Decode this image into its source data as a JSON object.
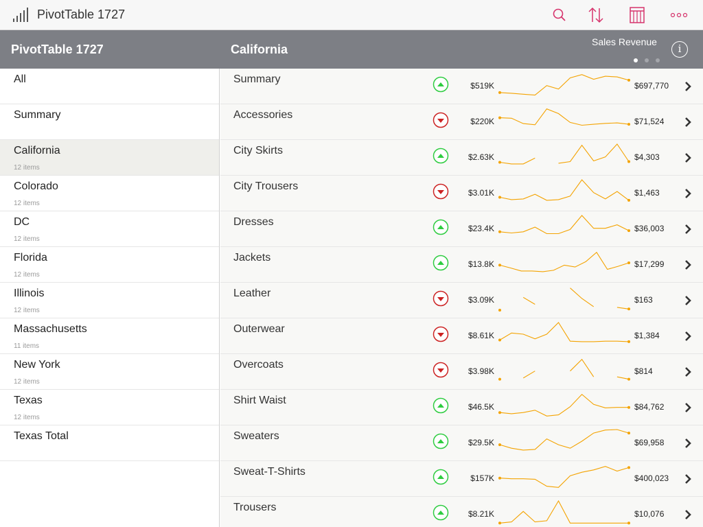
{
  "app": {
    "title": "PivotTable 1727",
    "logo_icon": "bar-chart-logo-icon"
  },
  "toolbar": {
    "icons": [
      "search-icon",
      "sort-icon",
      "columns-icon",
      "more-icon"
    ],
    "accent_color": "#d6336c"
  },
  "left_panel": {
    "title": "PivotTable 1727",
    "items": [
      {
        "label": "All",
        "sub": ""
      },
      {
        "label": "Summary",
        "sub": ""
      },
      {
        "label": "California",
        "sub": "12 items"
      },
      {
        "label": "Colorado",
        "sub": "12 items"
      },
      {
        "label": "DC",
        "sub": "12 items"
      },
      {
        "label": "Florida",
        "sub": "12 items"
      },
      {
        "label": "Illinois",
        "sub": "12 items"
      },
      {
        "label": "Massachusetts",
        "sub": "11 items"
      },
      {
        "label": "New York",
        "sub": "12 items"
      },
      {
        "label": "Texas",
        "sub": "12 items"
      },
      {
        "label": "Texas  Total",
        "sub": ""
      }
    ],
    "selected": "California"
  },
  "right_panel": {
    "title": "California",
    "measure": "Sales Revenue",
    "page_dots": 3,
    "active_dot": 0
  },
  "colors": {
    "up": "#2ecc40",
    "down": "#cc2222",
    "spark": "#f4a300",
    "header_bg": "#7d7f85"
  },
  "rows": [
    {
      "label": "Summary",
      "trend": "up",
      "start": "$519K",
      "end": "$697,770",
      "spark": [
        0.15,
        0.12,
        0.08,
        0.04,
        0.45,
        0.3,
        0.78,
        0.92,
        0.72,
        0.85,
        0.82,
        0.68
      ]
    },
    {
      "label": "Accessories",
      "trend": "down",
      "start": "$220K",
      "end": "$71,524",
      "spark": [
        0.6,
        0.58,
        0.35,
        0.3,
        0.98,
        0.78,
        0.4,
        0.28,
        0.32,
        0.36,
        0.38,
        0.32
      ]
    },
    {
      "label": "City Skirts",
      "trend": "up",
      "start": "$2.63K",
      "end": "$4,303",
      "spark": [
        0.22,
        0.15,
        0.15,
        0.4,
        null,
        0.18,
        0.25,
        0.95,
        0.28,
        0.45,
        1.0,
        0.25
      ]
    },
    {
      "label": "City Trousers",
      "trend": "down",
      "start": "$3.01K",
      "end": "$1,463",
      "spark": [
        0.25,
        0.15,
        0.18,
        0.38,
        0.12,
        0.15,
        0.3,
        1.0,
        0.45,
        0.18,
        0.5,
        0.12
      ]
    },
    {
      "label": "Dresses",
      "trend": "up",
      "start": "$23.4K",
      "end": "$36,003",
      "spark": [
        0.3,
        0.25,
        0.3,
        0.5,
        0.22,
        0.22,
        0.4,
        1.0,
        0.45,
        0.45,
        0.6,
        0.35
      ]
    },
    {
      "label": "Jackets",
      "trend": "up",
      "start": "$13.8K",
      "end": "$17,299",
      "spark": [
        0.4,
        0.28,
        0.15,
        0.15,
        0.12,
        0.18,
        0.4,
        0.32,
        0.55,
        0.95,
        0.22,
        0.35,
        0.5
      ]
    },
    {
      "label": "Leather",
      "trend": "down",
      "start": "$3.09K",
      "end": "$163",
      "spark": [
        0.0,
        null,
        0.55,
        0.25,
        null,
        null,
        0.95,
        0.5,
        0.15,
        null,
        0.12,
        0.05
      ]
    },
    {
      "label": "Outerwear",
      "trend": "down",
      "start": "$8.61K",
      "end": "$1,384",
      "spark": [
        0.25,
        0.55,
        0.5,
        0.3,
        0.5,
        1.0,
        0.2,
        0.18,
        0.18,
        0.2,
        0.2,
        0.18
      ]
    },
    {
      "label": "Overcoats",
      "trend": "down",
      "start": "$3.98K",
      "end": "$814",
      "spark": [
        0.1,
        null,
        0.15,
        0.45,
        null,
        null,
        0.45,
        0.95,
        0.2,
        null,
        0.2,
        0.1
      ]
    },
    {
      "label": "Shirt Waist",
      "trend": "up",
      "start": "$46.5K",
      "end": "$84,762",
      "spark": [
        0.2,
        0.15,
        0.2,
        0.3,
        0.05,
        0.1,
        0.45,
        0.98,
        0.55,
        0.4,
        0.42,
        0.42
      ]
    },
    {
      "label": "Sweaters",
      "trend": "up",
      "start": "$29.5K",
      "end": "$69,958",
      "spark": [
        0.35,
        0.2,
        0.12,
        0.15,
        0.6,
        0.35,
        0.2,
        0.5,
        0.85,
        0.98,
        1.0,
        0.85
      ]
    },
    {
      "label": "Sweat-T-Shirts",
      "trend": "up",
      "start": "$157K",
      "end": "$400,023",
      "spark": [
        0.45,
        0.42,
        0.42,
        0.4,
        0.1,
        0.05,
        0.55,
        0.7,
        0.8,
        0.95,
        0.75,
        0.9
      ]
    },
    {
      "label": "Trousers",
      "trend": "up",
      "start": "$8.21K",
      "end": "$10,076",
      "spark": [
        0.05,
        0.1,
        0.55,
        0.1,
        0.15,
        1.0,
        0.05,
        0.05,
        0.05,
        0.05,
        0.05,
        0.05
      ]
    }
  ]
}
